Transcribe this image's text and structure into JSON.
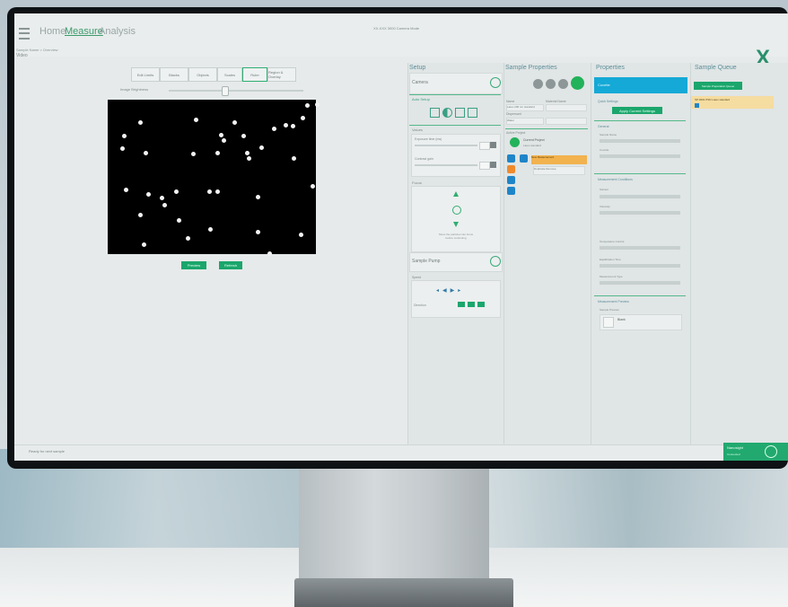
{
  "app": {
    "window_title": "XX-XXX 3000 Camera Mode",
    "nav": [
      "Home",
      "Measure",
      "Analysis"
    ],
    "active_nav": "Measure",
    "breadcrumb": "Sample Name > Overview",
    "view_label": "Video"
  },
  "video": {
    "tools": [
      "Edit Limits",
      "Blacks",
      "Objects",
      "Scales",
      "Ruler",
      "Region & Overlay"
    ],
    "selected_tool": "Ruler",
    "slider_label": "Image Brightness",
    "buttons": [
      "Preview",
      "Refresh"
    ]
  },
  "setup": {
    "title": "Setup",
    "camera": "Camera",
    "auto_setup": "Auto Setup",
    "values": "Values",
    "exposure": "Exposure time (ms)",
    "contrast": "Contrast gain",
    "focus": "Focus",
    "focus_hint": "Move the particles into focus before continuing",
    "sample_pump": "Sample Pump",
    "speed": "Speed",
    "direction": "Direction"
  },
  "sample_properties": {
    "title": "Sample Properties",
    "name_label": "Name",
    "name_value": "Latex 200 nm standard",
    "material_label": "Material Name",
    "dispersant_label": "Dispersant",
    "dispersant_value": "Water",
    "active_project": "Active Project",
    "project_name": "Current Project",
    "project_item": "Latex standard",
    "menu_item": "New Measurement",
    "menu_actions": [
      "Duplicate",
      "Remove"
    ]
  },
  "properties": {
    "title": "Properties",
    "tab": "Cuvette",
    "sections": [
      "Quick Settings",
      "General",
      "Measurement Conditions",
      "Measurement Preview"
    ],
    "apply_button": "Apply Current Settings",
    "fields": [
      "Sample Name",
      "Cuvette",
      "Solvent",
      "Viscosity",
      "Temperature Control",
      "Equilibration Time",
      "Measurement Type"
    ],
    "preview_label": "Sample Preview",
    "preview_value": "Blank"
  },
  "sample_queue": {
    "title": "Sample Queue",
    "tab": "Sample Preparation Queue",
    "entry": "SP 0001 PSD Latex standard"
  },
  "status": {
    "text": "Ready for next sample",
    "badge_title": "Nanosight",
    "badge_sub": "Connected"
  }
}
